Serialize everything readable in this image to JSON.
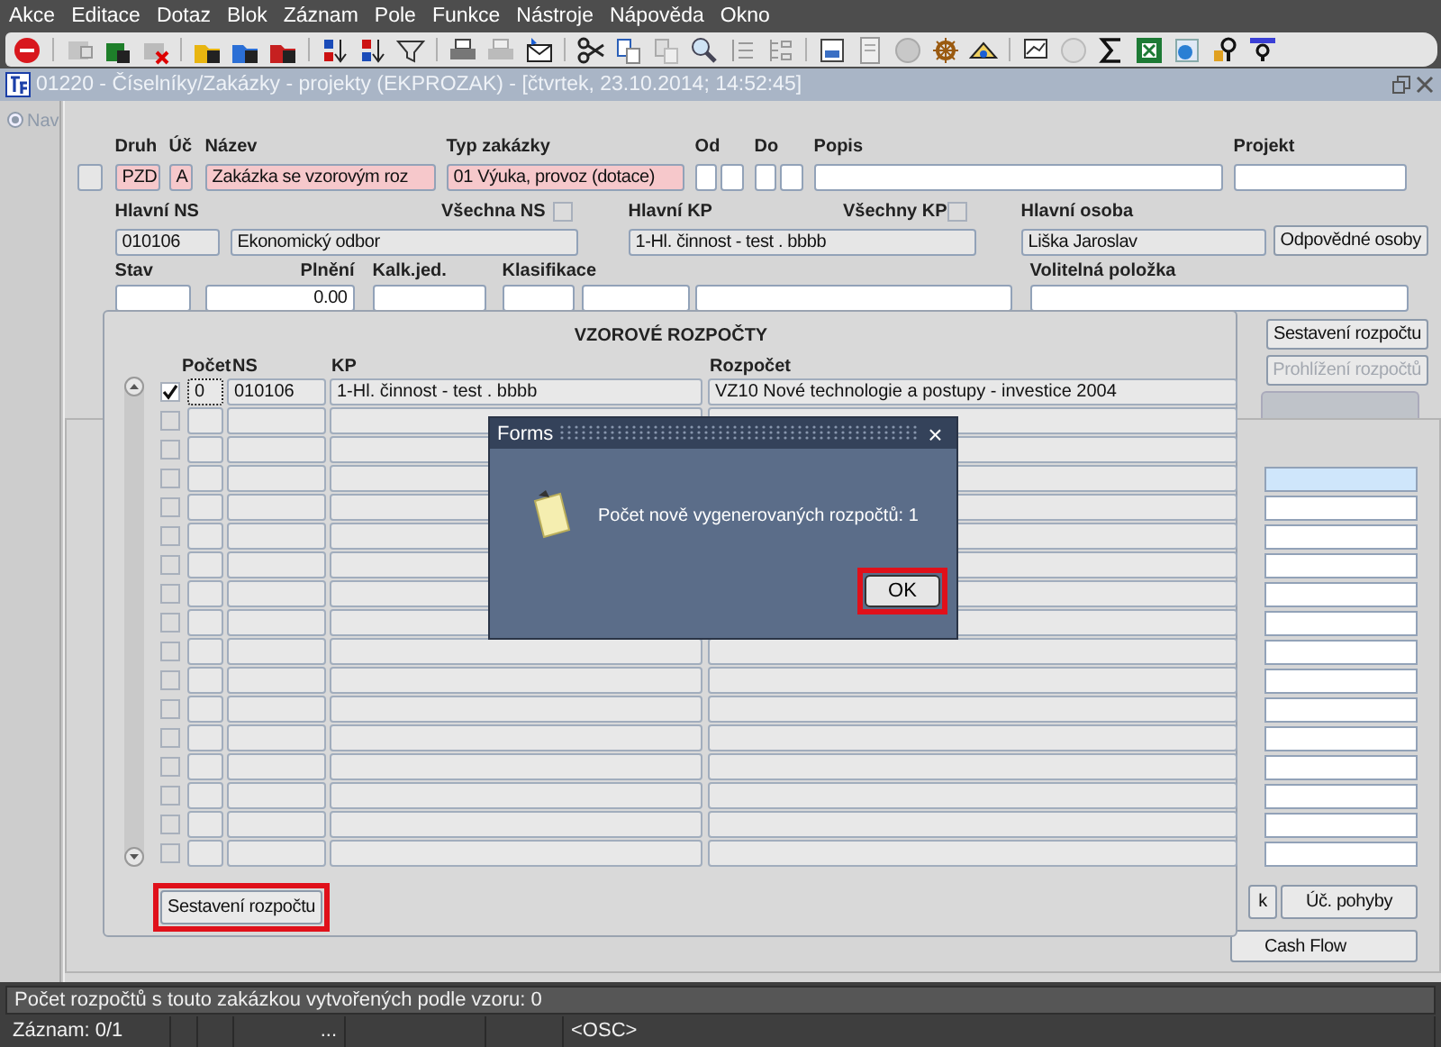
{
  "menu": [
    "Akce",
    "Editace",
    "Dotaz",
    "Blok",
    "Záznam",
    "Pole",
    "Funkce",
    "Nástroje",
    "Nápověda",
    "Okno"
  ],
  "window": {
    "title": "01220 - Číselníky/Zakázky - projekty (EKPROZAK) - [čtvrtek, 23.10.2014; 14:52:45]"
  },
  "nav": {
    "label": "Nav"
  },
  "row1": {
    "druh": {
      "label": "Druh",
      "value": "PZD",
      "required": true
    },
    "uc": {
      "label": "Úč",
      "value": "A",
      "required": true
    },
    "nazev": {
      "label": "Název",
      "value": "Zakázka se vzorovým roz",
      "required": true
    },
    "typ": {
      "label": "Typ zakázky",
      "value": "01 Výuka, provoz (dotace)",
      "required": true
    },
    "od": {
      "label": "Od"
    },
    "do": {
      "label": "Do"
    },
    "popis": {
      "label": "Popis"
    },
    "projekt": {
      "label": "Projekt"
    }
  },
  "row2": {
    "hlavni_ns": {
      "label": "Hlavní NS",
      "code": "010106",
      "name": "Ekonomický odbor"
    },
    "vsechna_ns": {
      "label": "Všechna NS",
      "checked": false
    },
    "hlavni_kp": {
      "label": "Hlavní KP",
      "value": "1-Hl. činnost - test . bbbb"
    },
    "vsechny_kp": {
      "label": "Všechny KP",
      "checked": false
    },
    "hlavni_osoba": {
      "label": "Hlavní osoba",
      "value": "Liška Jaroslav"
    },
    "button": "Odpovědné osoby"
  },
  "row3": {
    "stav": {
      "label": "Stav"
    },
    "plneni": {
      "label": "Plnění",
      "value": "0.00"
    },
    "kalk": {
      "label": "Kalk.jed."
    },
    "klasifikace": {
      "label": "Klasifikace"
    },
    "volitelna": {
      "label": "Volitelná položka"
    }
  },
  "side_buttons": [
    {
      "label": "Sestavení rozpočtu",
      "disabled": false
    },
    {
      "label": "Prohlížení rozpočtů",
      "disabled": true
    }
  ],
  "background_list": [
    {
      "selected": true
    },
    {
      "selected": false
    },
    {
      "selected": false
    },
    {
      "selected": false
    },
    {
      "selected": false
    },
    {
      "selected": false
    },
    {
      "selected": false
    },
    {
      "selected": false
    },
    {
      "selected": false
    },
    {
      "selected": false
    },
    {
      "selected": false
    },
    {
      "selected": false
    },
    {
      "selected": false
    },
    {
      "selected": false
    }
  ],
  "bottom_buttons": [
    {
      "label": "k"
    },
    {
      "label": "Úč. pohyby"
    },
    {
      "label": "Cash Flow"
    }
  ],
  "template_window": {
    "title": "VZOROVÉ ROZPOČTY",
    "columns": [
      "Počet",
      "NS",
      "KP",
      "Rozpočet"
    ],
    "rows": [
      {
        "checked": true,
        "focused": true,
        "pocet": "0",
        "ns": "010106",
        "kp": "1-Hl. činnost - test . bbbb",
        "rozpocet": "VZ10 Nové technologie a postupy - investice 2004"
      },
      {
        "checked": false,
        "focused": false
      },
      {
        "checked": false,
        "focused": false
      },
      {
        "checked": false,
        "focused": false
      },
      {
        "checked": false,
        "focused": false
      },
      {
        "checked": false,
        "focused": false
      },
      {
        "checked": false,
        "focused": false
      },
      {
        "checked": false,
        "focused": false
      },
      {
        "checked": false,
        "focused": false
      },
      {
        "checked": false,
        "focused": false
      },
      {
        "checked": false,
        "focused": false
      },
      {
        "checked": false,
        "focused": false
      },
      {
        "checked": false,
        "focused": false
      },
      {
        "checked": false,
        "focused": false
      },
      {
        "checked": false,
        "focused": false
      },
      {
        "checked": false,
        "focused": false
      },
      {
        "checked": false,
        "focused": false
      }
    ],
    "button": {
      "label": "Sestavení rozpočtu",
      "highlighted": true
    }
  },
  "dialog": {
    "title": "Forms",
    "close": "×",
    "message": "Počet nově vygenerovaných rozpočtů: 1",
    "button": {
      "label": "OK",
      "highlighted": true
    }
  },
  "status": {
    "message": "Počet rozpočtů s touto zakázkou vytvořených podle vzoru: 0",
    "record": "Záznam: 0/1",
    "segment_4": "...",
    "mode": "<OSC>"
  }
}
